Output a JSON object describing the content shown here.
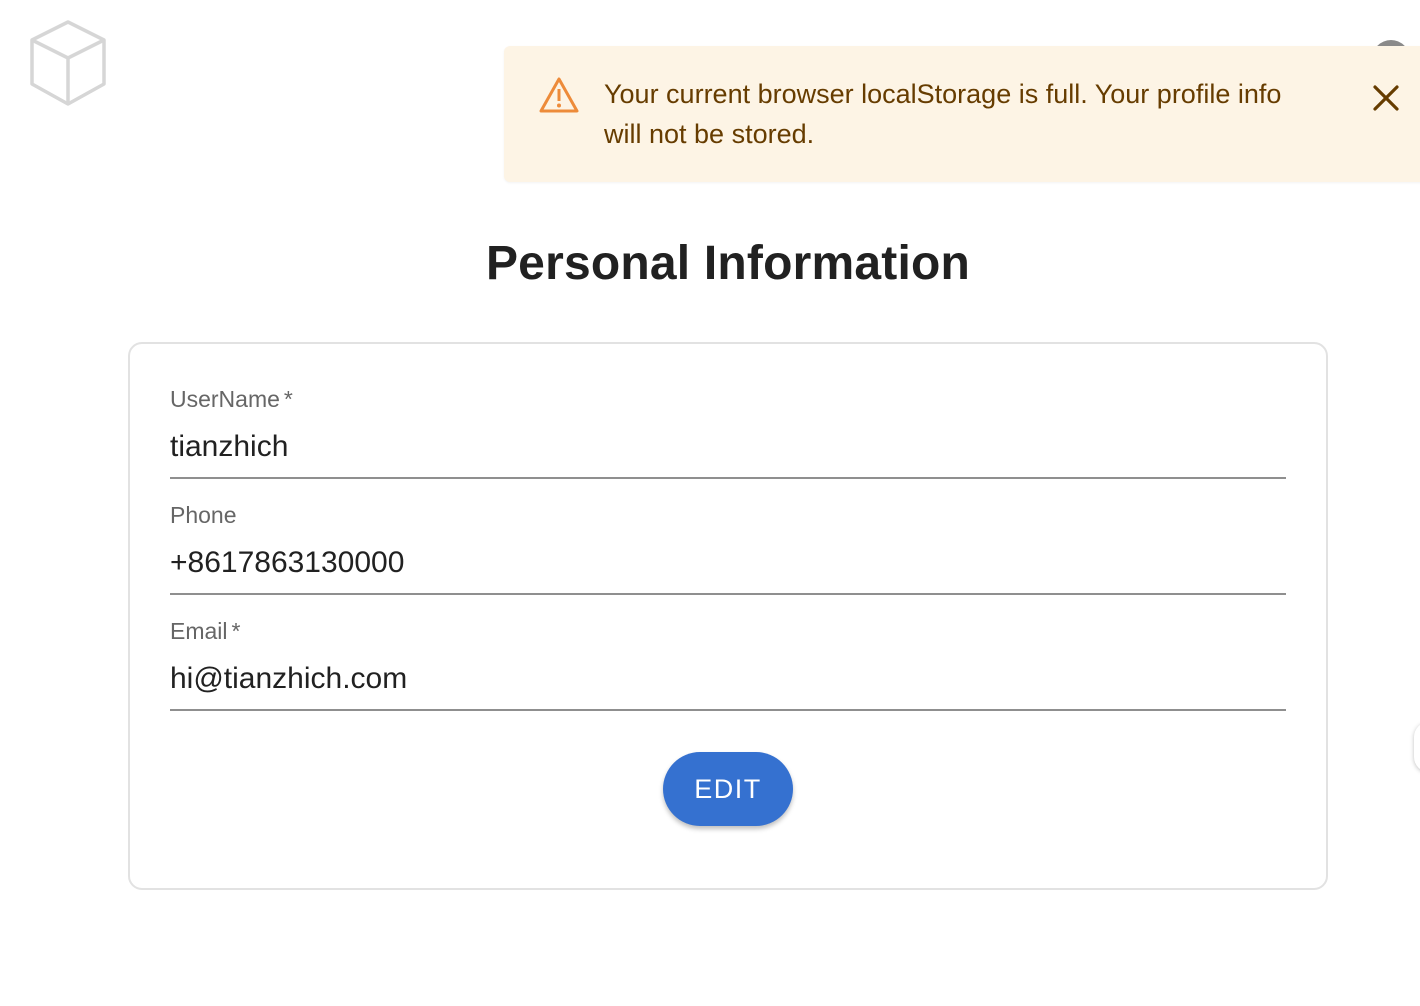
{
  "header": {
    "logo_icon": "cube-icon",
    "avatar_icon": "user-avatar-icon"
  },
  "alert": {
    "severity": "warning",
    "icon": "warning-triangle-icon",
    "message": "Your current browser localStorage is full. Your profile info will not be stored.",
    "close_icon": "close-icon",
    "background_color": "#fdf4e5",
    "text_color": "#663c00",
    "icon_color": "#ed8b3a"
  },
  "page": {
    "title": "Personal Information"
  },
  "form": {
    "fields": [
      {
        "label": "UserName",
        "required_mark": "*",
        "value": "tianzhich"
      },
      {
        "label": "Phone",
        "required_mark": "",
        "value": "+8617863130000"
      },
      {
        "label": "Email",
        "required_mark": "*",
        "value": "hi@tianzhich.com"
      }
    ],
    "edit_label": "EDIT",
    "accent_color": "#3571d0"
  }
}
